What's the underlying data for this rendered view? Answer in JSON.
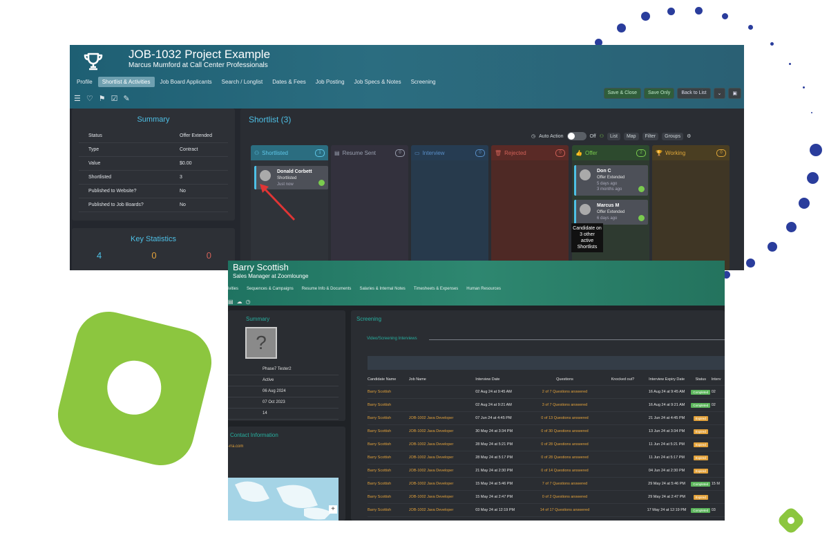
{
  "colors": {
    "accent_blue": "#4ec0e6",
    "green_brand": "#8cc63f",
    "dots": "#2a3d9c",
    "teal": "#27b0a0",
    "orange": "#e3a23b"
  },
  "shot1": {
    "title": "JOB-1032 Project Example",
    "subtitle": "Marcus Mumford at Call Center Professionals",
    "tabs": [
      "Profile",
      "Shortlist & Activities",
      "Job Board Applicants",
      "Search / Longlist",
      "Dates & Fees",
      "Job Posting",
      "Job Specs & Notes",
      "Screening"
    ],
    "active_tab": "Shortlist & Activities",
    "actions": {
      "save_close": "Save & Close",
      "save_only": "Save Only",
      "back": "Back to List"
    },
    "summary": {
      "title": "Summary",
      "rows": [
        {
          "k": "Status",
          "v": "Offer Extended"
        },
        {
          "k": "Type",
          "v": "Contract"
        },
        {
          "k": "Value",
          "v": "$0.00"
        },
        {
          "k": "Shortlisted",
          "v": "3"
        },
        {
          "k": "Published to Website?",
          "v": "No"
        },
        {
          "k": "Published to Job Boards?",
          "v": "No"
        }
      ]
    },
    "key_stats": {
      "title": "Key Statistics",
      "values": [
        "4",
        "0",
        "0"
      ]
    },
    "board": {
      "title": "Shortlist (3)",
      "auto_action": "Auto Action",
      "toggle": "Off",
      "list": "List",
      "map": "Map",
      "filter": "Filter",
      "groups": "Groups",
      "columns": [
        {
          "label": "Shortlisted",
          "count": "1",
          "color": "#2b6d80",
          "text": "#5fc7e8",
          "bg": "#2f3339"
        },
        {
          "label": "Resume Sent",
          "count": "0",
          "color": "#33313d",
          "text": "#9aa0b0",
          "bg": "#33313d"
        },
        {
          "label": "Interview",
          "count": "0",
          "color": "#263c52",
          "text": "#5a8fc8",
          "bg": "#273a4c"
        },
        {
          "label": "Rejected",
          "count": "0",
          "color": "#5a2a26",
          "text": "#d06158",
          "bg": "#4e2925"
        },
        {
          "label": "Offer",
          "count": "2",
          "color": "#2d4a2e",
          "text": "#7acb4e",
          "bg": "#2e3a30"
        },
        {
          "label": "Working",
          "count": "0",
          "color": "#4a3e22",
          "text": "#e0a83a",
          "bg": "#3f3625"
        }
      ],
      "cards": [
        {
          "name": "Donald Corbett",
          "status": "Shortlisted",
          "time": "Just now"
        },
        {
          "name": "Don C",
          "status": "Offer Extended",
          "time": "5 days ago",
          "time2": "3 months ago"
        },
        {
          "name": "Marcus M",
          "status": "Offer Extended",
          "time": "6 days ago"
        }
      ],
      "tooltip": "Candidate on 3 other active Shortlists"
    }
  },
  "shot2": {
    "title": "Barry Scottish",
    "subtitle": "Sales Manager at Zoomlounge",
    "tabs": [
      "ivities",
      "Sequences & Campaigns",
      "Resume Info & Documents",
      "Salaries & Internal Notes",
      "Timesheets & Expenses",
      "Human Resources"
    ],
    "summary_title": "Summary",
    "summary_rows": [
      "Phase7 Tester2",
      "Active",
      "06 Aug 2024",
      "07 Oct 2023",
      "14"
    ],
    "contact_title": "Contact Information",
    "contact_email": "-rra.com",
    "screening_title": "Screening",
    "section_title": "Video/Screening Interviews",
    "headers": [
      "Candidate Name",
      "Job Name",
      "Interview Date",
      "Questions",
      "Knocked out?",
      "Interview Expiry Date",
      "Status",
      "Interv"
    ],
    "rows": [
      {
        "c": "Barry Scottish",
        "j": "",
        "d": "02 Aug 24 at 9:45 AM",
        "q": "2 of 7 Questions answered",
        "e": "16 Aug 24 at 9:45 AM",
        "s": "Completed",
        "sc": "#5bb55b",
        "x": "02"
      },
      {
        "c": "Barry Scottish",
        "j": "",
        "d": "02 Aug 24 at 9:21 AM",
        "q": "3 of 7 Questions answered",
        "e": "16 Aug 24 at 9:21 AM",
        "s": "Completed",
        "sc": "#5bb55b",
        "x": "02"
      },
      {
        "c": "Barry Scottish",
        "j": "JOB-1002 Java Developer",
        "d": "07 Jun 24 at 4:45 PM",
        "q": "0 of 13 Questions answered",
        "e": "21 Jun 24 at 4:45 PM",
        "s": "Expired",
        "sc": "#e3a23b",
        "x": ""
      },
      {
        "c": "Barry Scottish",
        "j": "JOB-1002 Java Developer",
        "d": "30 May 24 at 3:34 PM",
        "q": "0 of 30 Questions answered",
        "e": "13 Jun 24 at 3:34 PM",
        "s": "Expired",
        "sc": "#e3a23b",
        "x": ""
      },
      {
        "c": "Barry Scottish",
        "j": "JOB-1002 Java Developer",
        "d": "28 May 24 at 5:21 PM",
        "q": "0 of 28 Questions answered",
        "e": "11 Jun 24 at 5:21 PM",
        "s": "Expired",
        "sc": "#e3a23b",
        "x": ""
      },
      {
        "c": "Barry Scottish",
        "j": "JOB-1002 Java Developer",
        "d": "28 May 24 at 5:17 PM",
        "q": "0 of 28 Questions answered",
        "e": "11 Jun 24 at 5:17 PM",
        "s": "Expired",
        "sc": "#e3a23b",
        "x": ""
      },
      {
        "c": "Barry Scottish",
        "j": "JOB-1002 Java Developer",
        "d": "21 May 24 at 2:30 PM",
        "q": "0 of 14 Questions answered",
        "e": "04 Jun 24 at 2:30 PM",
        "s": "Expired",
        "sc": "#e3a23b",
        "x": ""
      },
      {
        "c": "Barry Scottish",
        "j": "JOB-1002 Java Developer",
        "d": "15 May 24 at 5:46 PM",
        "q": "7 of 7 Questions answered",
        "e": "29 May 24 at 5:46 PM",
        "s": "Completed",
        "sc": "#5bb55b",
        "x": "15 M"
      },
      {
        "c": "Barry Scottish",
        "j": "JOB-1002 Java Developer",
        "d": "15 May 24 at 2:47 PM",
        "q": "0 of 2 Questions answered",
        "e": "29 May 24 at 2:47 PM",
        "s": "Expired",
        "sc": "#e3a23b",
        "x": ""
      },
      {
        "c": "Barry Scottish",
        "j": "JOB-1002 Java Developer",
        "d": "03 May 24 at 12:19 PM",
        "q": "14 of 17 Questions answered",
        "e": "17 May 24 at 12:19 PM",
        "s": "Completed",
        "sc": "#5bb55b",
        "x": "03"
      }
    ]
  }
}
